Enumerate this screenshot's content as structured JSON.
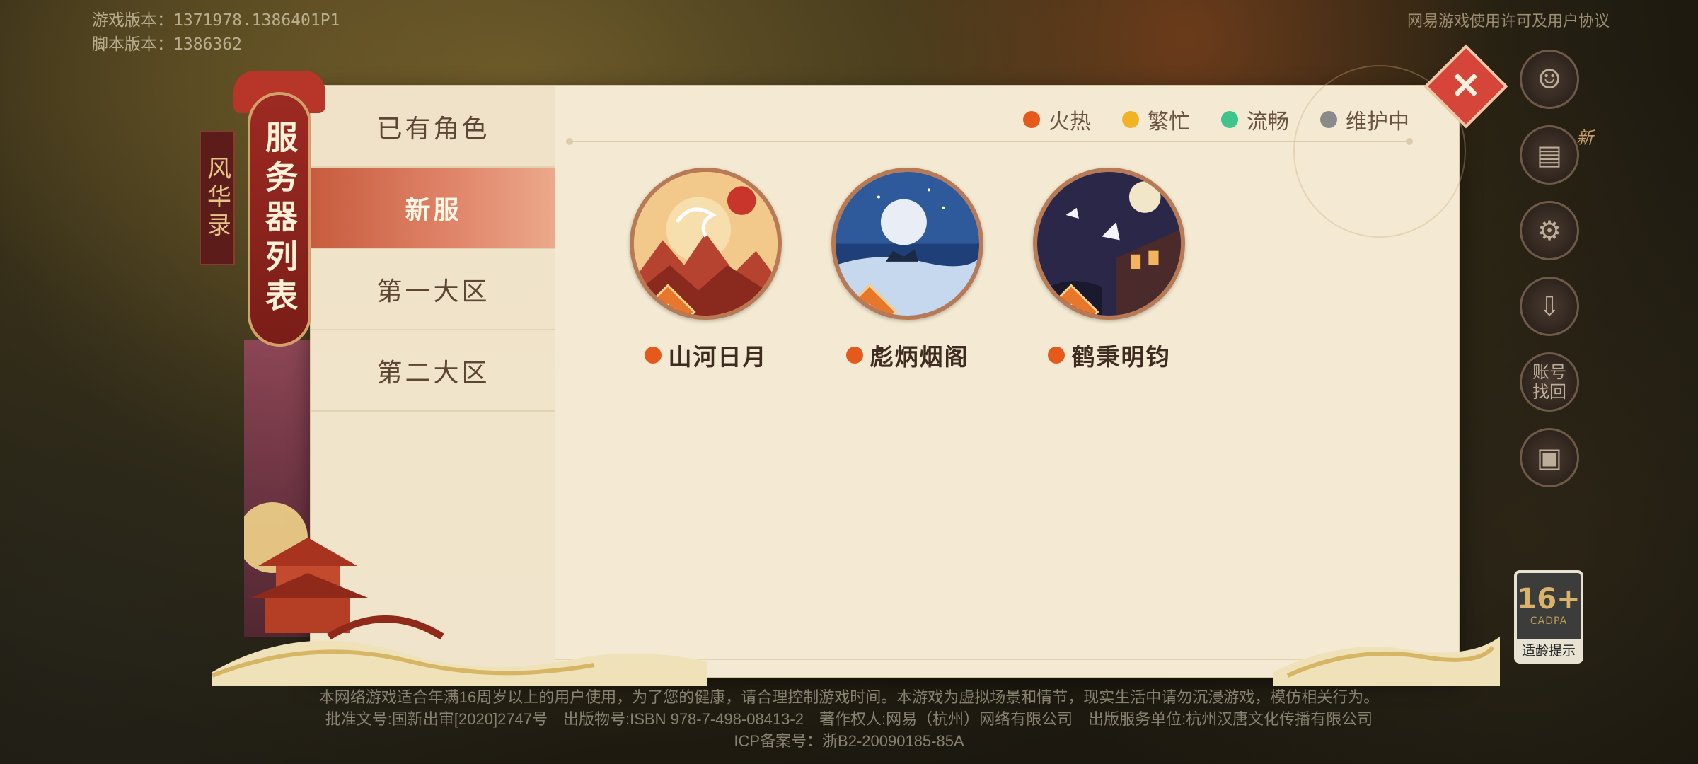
{
  "version_info": {
    "game_version": "游戏版本：1371978.1386401P1",
    "script_version": "脚本版本：1386362"
  },
  "top_link": "网易游戏使用许可及用户协议",
  "banner": {
    "title": "服务器列表",
    "side_tag": "风华录"
  },
  "sidebar": {
    "items": [
      {
        "label": "已有角色",
        "active": false
      },
      {
        "label": "新服",
        "active": true
      },
      {
        "label": "第一大区",
        "active": false
      },
      {
        "label": "第二大区",
        "active": false
      }
    ]
  },
  "legend": [
    {
      "label": "火热",
      "color": "#e55a1c"
    },
    {
      "label": "繁忙",
      "color": "#f0b323"
    },
    {
      "label": "流畅",
      "color": "#3fc48b"
    },
    {
      "label": "维护中",
      "color": "#8a8a8a"
    }
  ],
  "servers": [
    {
      "name": "山河日月",
      "status_color": "#e55a1c",
      "badge": "火",
      "icon": "mountain-dragon-icon"
    },
    {
      "name": "彪炳烟阁",
      "status_color": "#e55a1c",
      "badge": "火",
      "icon": "moon-cavalry-icon"
    },
    {
      "name": "鹤秉明钧",
      "status_color": "#e55a1c",
      "badge": "火",
      "icon": "crane-pavilion-icon"
    }
  ],
  "close_icon": "✕",
  "right_column": {
    "account_recovery": "账号找回",
    "new_tag": "新"
  },
  "age_rating": {
    "age": "16+",
    "org": "CADPA",
    "tip": "适龄提示"
  },
  "footer": {
    "line1": "本网络游戏适合年满16周岁以上的用户使用，为了您的健康，请合理控制游戏时间。本游戏为虚拟场景和情节，现实生活中请勿沉浸游戏，模仿相关行为。",
    "line2": "批准文号:国新出审[2020]2747号　出版物号:ISBN 978-7-498-08413-2　著作权人:网易（杭州）网络有限公司　出版服务单位:杭州汉唐文化传播有限公司",
    "line3": "ICP备案号：浙B2-20090185-85A"
  }
}
